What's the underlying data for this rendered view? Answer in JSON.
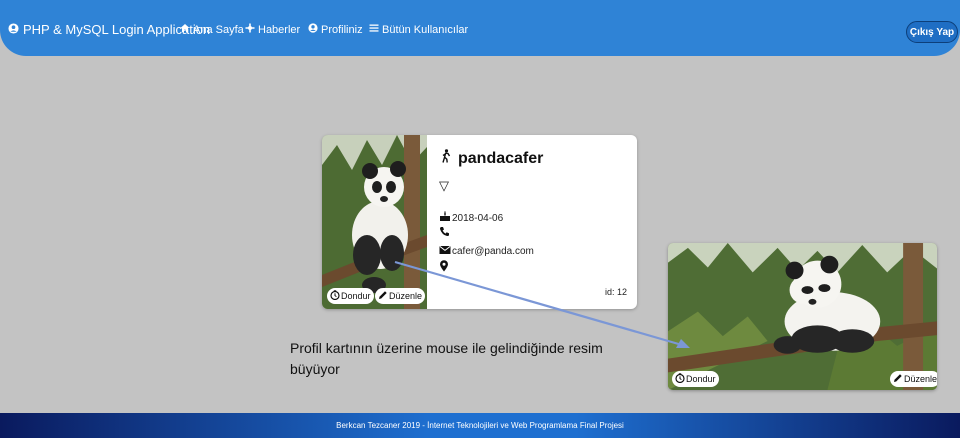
{
  "navbar": {
    "brand": "PHP & MySQL Login Application",
    "items": [
      {
        "label": "Ana Sayfa",
        "icon": "home-icon"
      },
      {
        "label": "Haberler",
        "icon": "news-icon"
      },
      {
        "label": "Profiliniz",
        "icon": "user-circle-icon"
      },
      {
        "label": "Bütün Kullanıcılar",
        "icon": "list-icon"
      }
    ],
    "logout": "Çıkış Yap",
    "color": "#2f83d6"
  },
  "profile": {
    "username": "pandacafer",
    "gender_symbol": "▽",
    "birthdate": "2018-04-06",
    "phone": "",
    "email": "cafer@panda.com",
    "location": "",
    "id_text": "id: 12",
    "freeze_label": "Dondur",
    "edit_label": "Düzenle"
  },
  "annotation": {
    "text": "Profil kartının üzerine mouse ile gelindiğinde resim büyüyor"
  },
  "footer": {
    "text": "Berkcan Tezcaner 2019 - İnternet Teknolojileri ve Web Programlama Final Projesi"
  }
}
